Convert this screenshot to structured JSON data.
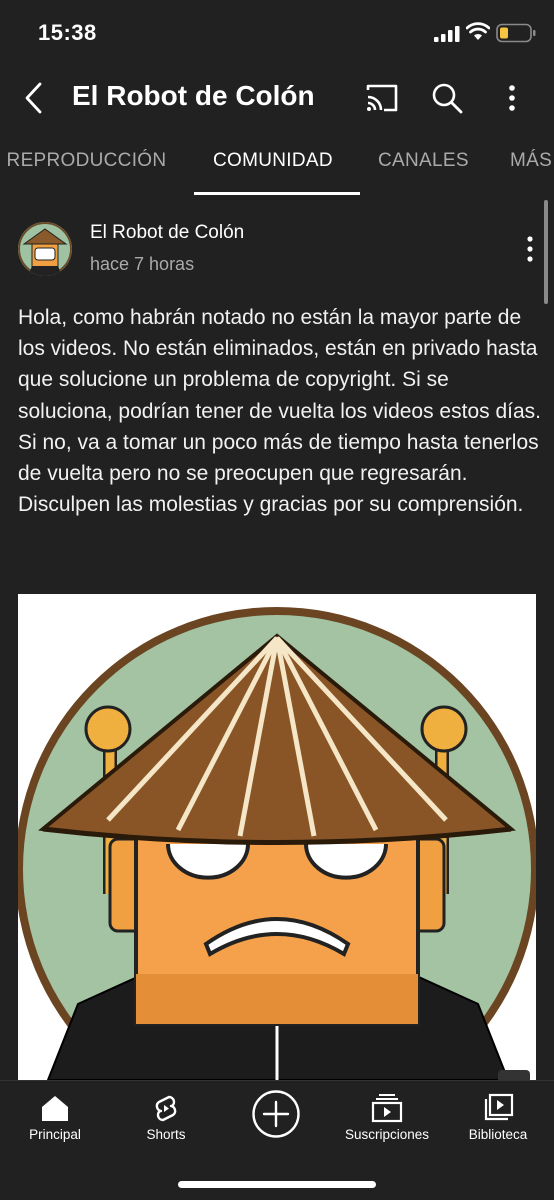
{
  "status_bar": {
    "time": "15:38"
  },
  "header": {
    "title": "El Robot de Colón"
  },
  "tabs": [
    {
      "label": "E REPRODUCCIÓN"
    },
    {
      "label": "COMUNIDAD"
    },
    {
      "label": "CANALES"
    },
    {
      "label": "MÁS"
    }
  ],
  "post": {
    "author": "El Robot de Colón",
    "time_ago": "hace 7 horas",
    "text": "Hola, como habrán notado no están la mayor parte de los videos. No están eliminados, están en privado hasta que solucione un problema de copyright. Si se soluciona, podrían tener de vuelta los videos estos días. Si no, va a tomar un poco más de tiempo hasta tenerlos de vuelta pero no se preocupen que regresarán. Disculpen las molestias y gracias por su comprensión."
  },
  "bottom_nav": {
    "items": [
      {
        "label": "Principal",
        "icon": "home-icon"
      },
      {
        "label": "Shorts",
        "icon": "shorts-icon"
      },
      {
        "label": "Suscripciones",
        "icon": "subscriptions-icon"
      },
      {
        "label": "Biblioteca",
        "icon": "library-icon"
      }
    ],
    "create_icon": "create-icon"
  },
  "colors": {
    "background": "#212121",
    "text": "#ffffff",
    "secondary_text": "#aaaaaa",
    "battery": "#f5c542"
  }
}
